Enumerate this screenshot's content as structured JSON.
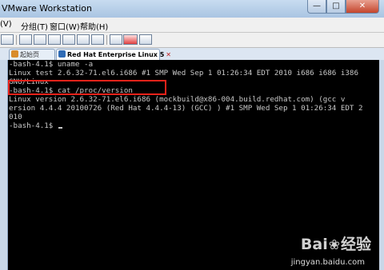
{
  "window": {
    "title": "VMware Workstation"
  },
  "window_controls": {
    "minimize": "—",
    "maximize": "□",
    "close": "✕"
  },
  "menubar": {
    "items": [
      {
        "label": "(V)"
      },
      {
        "label": "分组(T)"
      },
      {
        "label": "窗口(W)"
      },
      {
        "label": "帮助(H)"
      }
    ]
  },
  "tabs": [
    {
      "label": "起始页",
      "active": false
    },
    {
      "label": "Red Hat Enterprise Linux 5",
      "active": true
    }
  ],
  "terminal": {
    "lines": [
      "-bash-4.1$ uname -a",
      "Linux test 2.6.32-71.el6.i686 #1 SMP Wed Sep 1 01:26:34 EDT 2010 i686 i686 i386",
      "GNU/Linux",
      "-bash-4.1$ cat /proc/version",
      "Linux version 2.6.32-71.el6.i686 (mockbuild@x86-004.build.redhat.com) (gcc v",
      "ersion 4.4.4 20100726 (Red Hat 4.4.4-13) (GCC) ) #1 SMP Wed Sep 1 01:26:34 EDT 2",
      "010",
      "-bash-4.1$ "
    ]
  },
  "watermark": {
    "brand_left": "Bai",
    "brand_right": "经验",
    "site": "jingyan.baidu.com"
  },
  "colors": {
    "highlight_box": "#e8221a",
    "terminal_bg": "#000000",
    "terminal_fg": "#c8c8c8"
  }
}
